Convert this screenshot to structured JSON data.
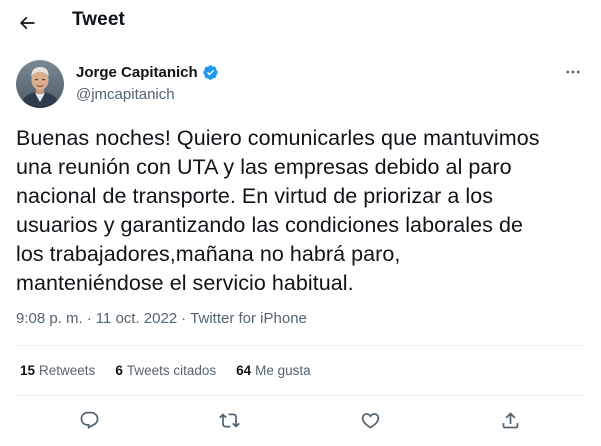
{
  "header": {
    "title": "Tweet"
  },
  "author": {
    "name": "Jorge Capitanich",
    "handle": "@jmcapitanich",
    "verified": true
  },
  "tweet": {
    "text": "Buenas noches! Quiero comunicarles que mantuvimos\nuna reunión con UTA y las empresas debido al paro\nnacional de transporte. En virtud de priorizar a los\nusuarios y garantizando las condiciones laborales de\nlos trabajadores,mañana no habrá paro,\nmanteniéndose el servicio habitual.",
    "time": "9:08 p. m.",
    "separator": "·",
    "date": "11 oct. 2022",
    "source": "Twitter for iPhone"
  },
  "stats": {
    "retweets_count": "15",
    "retweets_label": "Retweets",
    "quotes_count": "6",
    "quotes_label": "Tweets citados",
    "likes_count": "64",
    "likes_label": "Me gusta"
  },
  "colors": {
    "text_primary": "#0f1419",
    "text_secondary": "#536471",
    "divider": "#eff3f4",
    "verified_blue": "#1d9bf0"
  },
  "icons": {
    "back": "arrow-left-icon",
    "verified": "verified-badge-icon",
    "more": "more-horizontal-icon",
    "reply": "reply-icon",
    "retweet": "retweet-icon",
    "like": "heart-icon",
    "share": "share-icon"
  }
}
